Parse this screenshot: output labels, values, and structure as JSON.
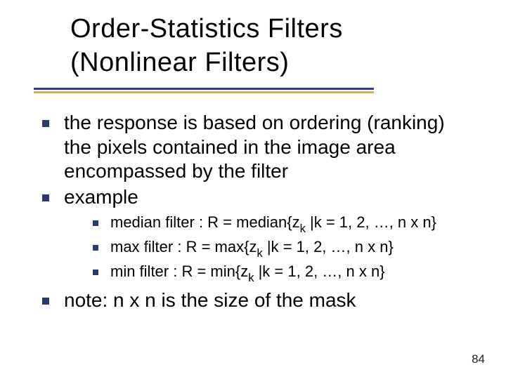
{
  "title": {
    "line1": "Order-Statistics Filters",
    "line2": "(Nonlinear Filters)"
  },
  "bullets": {
    "b1": "the response is based on ordering (ranking) the pixels contained in the image area encompassed by the filter",
    "b2": "example",
    "sub": {
      "s1_pre": "median filter : R = median{z",
      "s1_sub": "k",
      "s1_post": " |k = 1, 2, …, n x n}",
      "s2_pre": "max filter : R = max{z",
      "s2_sub": "k",
      "s2_post": " |k = 1, 2, …, n x n}",
      "s3_pre": "min filter : R = min{z",
      "s3_sub": "k",
      "s3_post": " |k = 1, 2, …, n x n}"
    },
    "b3": "note: n x n is the size of the mask"
  },
  "page_number": "84"
}
